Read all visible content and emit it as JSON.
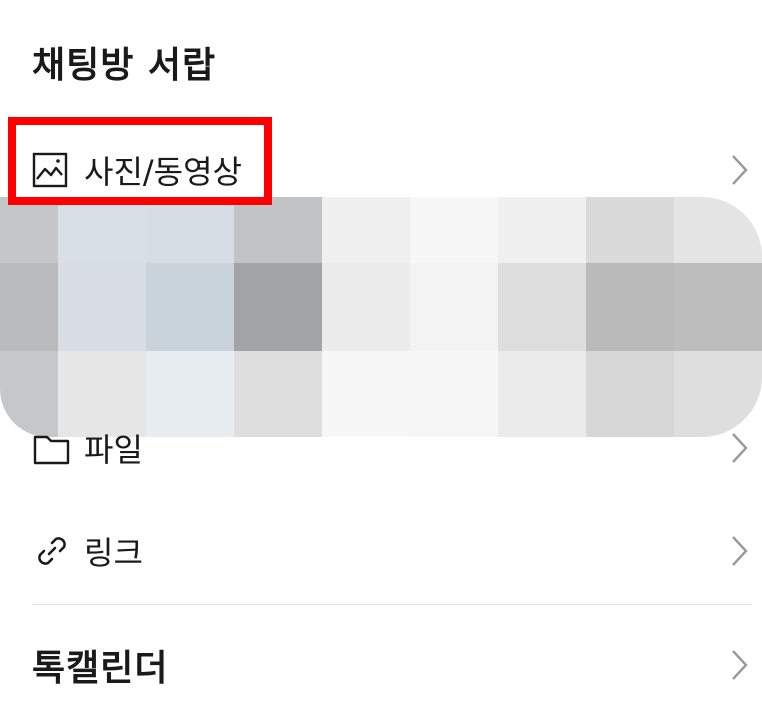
{
  "page": {
    "title": "채팅방 서랍"
  },
  "menu": {
    "photos": {
      "label": "사진/동영상",
      "icon": "image-icon"
    },
    "files": {
      "label": "파일",
      "icon": "folder-icon"
    },
    "links": {
      "label": "링크",
      "icon": "link-icon"
    },
    "calendar": {
      "label": "톡캘린더"
    }
  },
  "colors": {
    "highlight": "#ff0000",
    "text": "#1a1a1a",
    "chevron": "#9a9a9a",
    "divider": "#e2e2e2"
  }
}
